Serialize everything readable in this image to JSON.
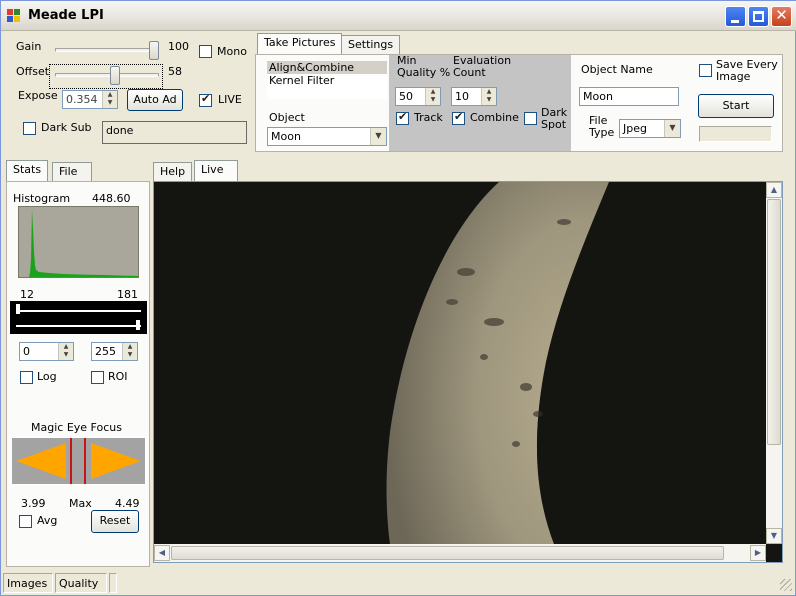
{
  "window": {
    "title": "Meade LPI"
  },
  "controls": {
    "gain_label": "Gain",
    "gain_value": "100",
    "gain_level": 1.0,
    "mono_label": "Mono",
    "offset_label": "Offset",
    "offset_value": "58",
    "offset_level": 0.58,
    "expose_label": "Expose",
    "expose_value": "0.354",
    "auto_adjust_label": "Auto Ad",
    "live_label": "LIVE",
    "dark_sub_label": "Dark Sub",
    "status_text": "done"
  },
  "capture": {
    "tabs": [
      "Take Pictures",
      "Settings"
    ],
    "modes": [
      "Align&Combine",
      "Kernel Filter"
    ],
    "object_label": "Object",
    "object_value": "Moon",
    "min_quality_label": "Min\nQuality %",
    "min_quality_value": "50",
    "evaluation_count_label": "Evaluation\nCount",
    "evaluation_count_value": "10",
    "track_label": "Track",
    "combine_label": "Combine",
    "dark_spot_label": "Dark\nSpot",
    "object_name_label": "Object Name",
    "object_name_value": "Moon",
    "file_type_label": "File\nType",
    "file_type_value": "Jpeg",
    "save_every_label": "Save Every\nImage",
    "start_label": "Start"
  },
  "left_panel": {
    "tabs": [
      "Stats",
      "File"
    ],
    "histogram_label": "Histogram",
    "histogram_value": "448.60",
    "range_low": "12",
    "range_high": "181",
    "min_value": "0",
    "max_value": "255",
    "log_label": "Log",
    "roi_label": "ROI",
    "magic_eye_label": "Magic Eye Focus",
    "focus_current": "3.99",
    "focus_max_label": "Max",
    "focus_max": "4.49",
    "avg_label": "Avg",
    "reset_label": "Reset"
  },
  "view": {
    "tabs": [
      "Help",
      "Live"
    ]
  },
  "statusbar": {
    "cells": [
      "Images",
      "Quality",
      ""
    ]
  },
  "icons": {
    "minimize": "minimize-icon",
    "maximize": "maximize-icon",
    "close": "close-icon",
    "focus_left": "triangle-left-icon",
    "focus_right": "triangle-right-icon"
  },
  "colors": {
    "accent": "#2559d6",
    "histogram": "#1aa31a",
    "focus_arrow": "#ffa500",
    "moon_sky": "#141511"
  }
}
